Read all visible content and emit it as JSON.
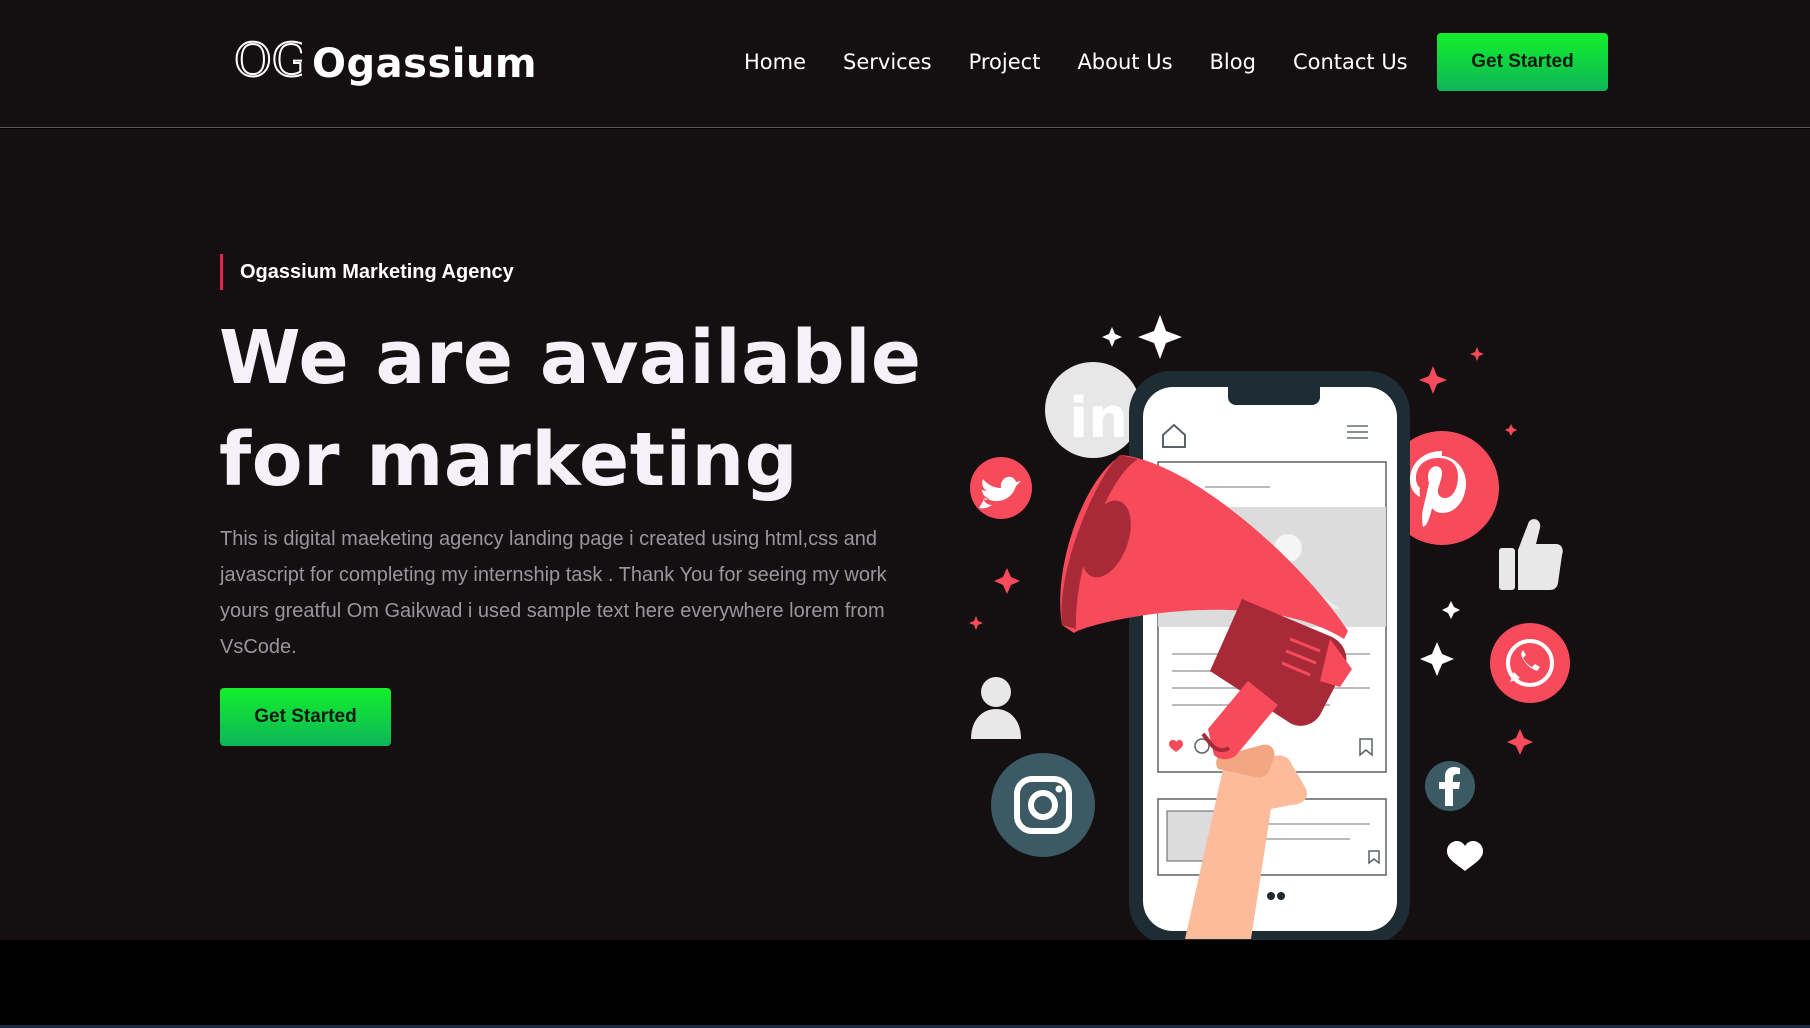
{
  "brand": {
    "name": "Ogassium",
    "logo_letters": "OG"
  },
  "nav": {
    "items": [
      {
        "label": "Home"
      },
      {
        "label": "Services"
      },
      {
        "label": "Project"
      },
      {
        "label": "About Us"
      },
      {
        "label": "Blog"
      },
      {
        "label": "Contact Us"
      }
    ],
    "cta_label": "Get Started"
  },
  "hero": {
    "tagline": "Ogassium Marketing Agency",
    "title_line1": "We are available",
    "title_line2": "for marketing",
    "description": "This is digital maeketing agency landing page i created using html,css and javascript for completing my internship task . Thank You for seeing my work yours greatful Om Gaikwad i used sample text here everywhere lorem from VsCode.",
    "cta_label": "Get Started",
    "illustration_icons": [
      "megaphone-icon",
      "phone-icon",
      "linkedin-icon",
      "twitter-icon",
      "pinterest-icon",
      "whatsapp-icon",
      "instagram-icon",
      "facebook-icon",
      "thumbs-up-icon",
      "user-icon",
      "heart-icon",
      "sparkle-icon"
    ],
    "illustration_text": {
      "linkedin": "in"
    }
  },
  "colors": {
    "background": "#140f10",
    "accent_red": "#f74a5a",
    "accent_green": "#12ef2a",
    "icon_slate": "#3b5a63"
  }
}
